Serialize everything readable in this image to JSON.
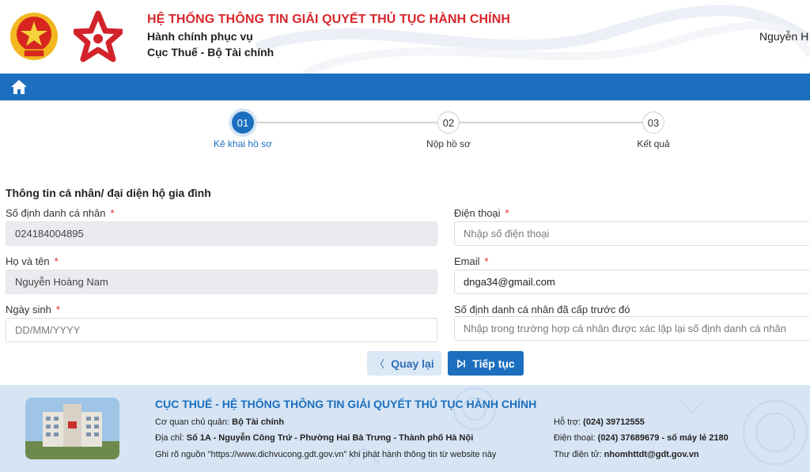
{
  "header": {
    "title": "HỆ THỐNG THÔNG TIN GIẢI QUYẾT THỦ TỤC HÀNH CHÍNH",
    "subtitle1": "Hành chính phục vụ",
    "subtitle2": "Cục Thuế - Bộ Tài chính",
    "user_name": "Nguyễn H"
  },
  "nav": {
    "home_icon": "home-icon"
  },
  "steps": [
    {
      "number": "01",
      "label": "Kê khai hồ sơ",
      "active": true
    },
    {
      "number": "02",
      "label": "Nộp hồ sơ",
      "active": false
    },
    {
      "number": "03",
      "label": "Kết quả",
      "active": false
    }
  ],
  "form": {
    "section_title": "Thông tin cá nhân/ đại diện hộ gia đình",
    "required_mark": "*",
    "id_number": {
      "label": "Số định danh cá nhân",
      "value": "024184004895"
    },
    "full_name": {
      "label": "Họ và tên",
      "value": "Nguyễn Hoàng Nam"
    },
    "birth_date": {
      "label": "Ngày sinh",
      "placeholder": "DD/MM/YYYY"
    },
    "phone": {
      "label": "Điện thoại",
      "placeholder": "Nhập số điện thoại"
    },
    "email": {
      "label": "Email",
      "value": "dnga34@gmail.com"
    },
    "previous_id": {
      "label": "Số định danh cá nhân đã cấp trước đó",
      "placeholder": "Nhập trong trường hợp cá nhân được xác lập lại số định danh cá nhân"
    }
  },
  "buttons": {
    "back": "Quay lại",
    "next": "Tiếp tục"
  },
  "footer": {
    "title": "CỤC THUẾ - HỆ THỐNG THÔNG TIN GIẢI QUYẾT THỦ TỤC HÀNH CHÍNH",
    "agency_label": "Cơ quan chủ quản:",
    "agency_value": "Bộ Tài chính",
    "address_label": "Địa chỉ:",
    "address_value": "Số 1A - Nguyễn Công Trứ - Phường Hai Bà Trưng - Thành phố Hà Nội",
    "source_note": "Ghi rõ nguồn \"https://www.dichvucong.gdt.gov.vn\" khi phát hành thông tin từ website này",
    "support_label": "Hỗ trợ:",
    "support_value": "(024) 39712555",
    "phone_label": "Điện thoại:",
    "phone_value": "(024) 37689679 - số máy lẻ 2180",
    "email_label": "Thư điện tử:",
    "email_value": "nhomhttdt@gdt.gov.vn"
  },
  "colors": {
    "brand_blue": "#1c6fbe",
    "title_red": "#d7262b",
    "footer_bg": "#d6e4f3"
  }
}
